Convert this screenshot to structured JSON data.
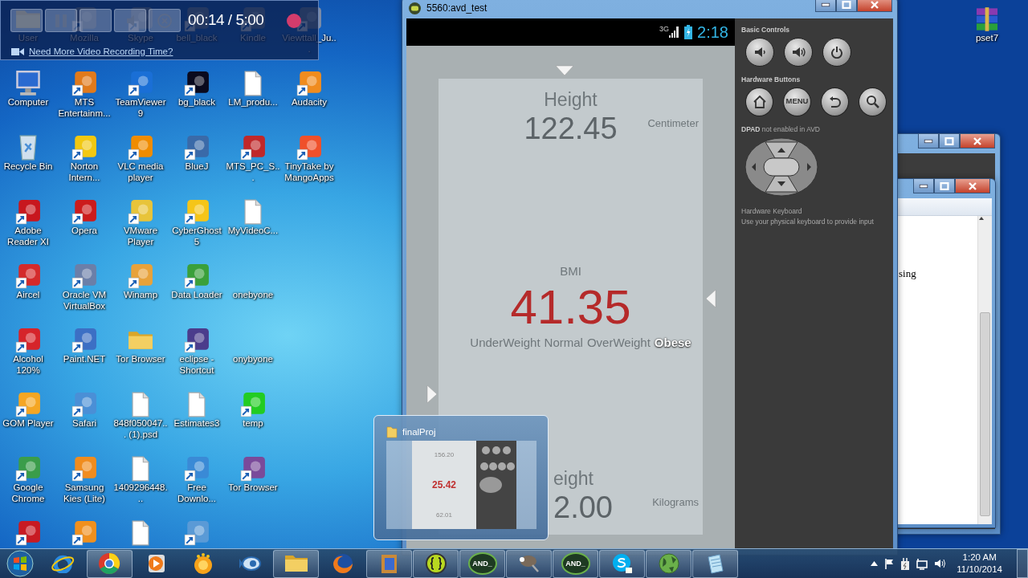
{
  "recorder": {
    "buttons": [
      {
        "kind": "blank"
      },
      {
        "kind": "pause"
      },
      {
        "kind": "blank"
      },
      {
        "kind": "mute"
      },
      {
        "kind": "cancel"
      }
    ],
    "timer": "00:14 / 5:00",
    "recording": true,
    "link": "Need More Video Recording Time?"
  },
  "desktop_icons": [
    {
      "label": "User",
      "kind": "folder"
    },
    {
      "label": "Computer",
      "kind": "computer"
    },
    {
      "label": "Recycle Bin",
      "kind": "bin"
    },
    {
      "label": "Adobe Reader XI",
      "kind": "app",
      "color": "#c8171e"
    },
    {
      "label": "Aircel",
      "kind": "app",
      "color": "#d42a2a"
    },
    {
      "label": "Alcohol 120%",
      "kind": "app",
      "color": "#d6242a"
    },
    {
      "label": "GOM Player",
      "kind": "app",
      "color": "#f5a623"
    },
    {
      "label": "Google Chrome",
      "kind": "app",
      "color": "#3a9d4a"
    },
    {
      "kind": "app",
      "color": "#c81a22"
    },
    {
      "label": "Mozilla",
      "kind": "app"
    },
    {
      "label": "MTS Entertainm...",
      "kind": "app",
      "color": "#e07a1c"
    },
    {
      "label": "Norton Intern...",
      "kind": "app",
      "color": "#f2c811"
    },
    {
      "label": "Opera",
      "kind": "app",
      "color": "#cc1b1b"
    },
    {
      "label": "Oracle VM VirtualBox",
      "kind": "app",
      "color": "#6b7fa8"
    },
    {
      "label": "Paint.NET",
      "kind": "app",
      "color": "#3c6fc4"
    },
    {
      "label": "Safari",
      "kind": "app",
      "color": "#4a8fd6"
    },
    {
      "label": "Samsung Kies (Lite)",
      "kind": "app",
      "color": "#f08c1e"
    },
    {
      "kind": "app",
      "color": "#f0901e"
    },
    {
      "label": "Skype",
      "kind": "app"
    },
    {
      "label": "TeamViewer 9",
      "kind": "app",
      "color": "#1a6fd6"
    },
    {
      "label": "VLC media player",
      "kind": "app",
      "color": "#f08c00"
    },
    {
      "label": "VMware Player",
      "kind": "app",
      "color": "#e8c43a"
    },
    {
      "label": "Winamp",
      "kind": "app",
      "color": "#e8a23a"
    },
    {
      "label": "Tor Browser",
      "kind": "folder"
    },
    {
      "label": "848f050047... (1).psd",
      "kind": "file"
    },
    {
      "label": "1409296448...",
      "kind": "file"
    },
    {
      "kind": "file"
    },
    {
      "label": "bell_black",
      "kind": "app"
    },
    {
      "label": "bg_black",
      "kind": "app",
      "color": "#0a0a1e"
    },
    {
      "label": "BlueJ",
      "kind": "app",
      "color": "#3a6aa8"
    },
    {
      "label": "CyberGhost 5",
      "kind": "app",
      "color": "#f5c518"
    },
    {
      "label": "Data Loader",
      "kind": "app",
      "color": "#3aa03a"
    },
    {
      "label": "eclipse - Shortcut",
      "kind": "app",
      "color": "#4b3c8c"
    },
    {
      "label": "Estimates3",
      "kind": "file"
    },
    {
      "label": "Free Downlo...",
      "kind": "app",
      "color": "#3a8ad6"
    },
    {
      "kind": "app",
      "color": "#5a9ad6"
    },
    {
      "label": "Kindle",
      "kind": "app"
    },
    {
      "label": "LM_produ...",
      "kind": "file"
    },
    {
      "label": "MTS_PC_S...",
      "kind": "app",
      "color": "#c0282a"
    },
    {
      "label": "MyVideoC...",
      "kind": "file"
    },
    {
      "label": "onebyone",
      "kind": "blank"
    },
    {
      "label": "onybyone",
      "kind": "blank"
    },
    {
      "label": "temp",
      "kind": "app",
      "color": "#22cc22"
    },
    {
      "label": "Tor Browser",
      "kind": "app",
      "color": "#7a4a9a"
    },
    {
      "kind": "blank"
    },
    {
      "label": "Viewttall_Ju...",
      "kind": "app"
    },
    {
      "label": "Audacity",
      "kind": "app",
      "color": "#f08c1e"
    },
    {
      "label": "TinyTake by MangoApps",
      "kind": "app",
      "color": "#f0502a"
    }
  ],
  "desktop_icon_right": {
    "label": "pset7"
  },
  "back_window": {
    "text": "sing"
  },
  "emulator": {
    "title": "5560:avd_test",
    "status_bar": {
      "network": "3G",
      "time": "2:18"
    },
    "height": {
      "label": "Height",
      "value": "122.45",
      "unit": "Centimeter"
    },
    "bmi": {
      "label": "BMI",
      "value": "41.35",
      "scale": [
        {
          "label": "UnderWeight",
          "selected": false
        },
        {
          "label": "Normal",
          "selected": false
        },
        {
          "label": "OverWeight",
          "selected": false
        },
        {
          "label": "Obese",
          "selected": true
        }
      ]
    },
    "weight": {
      "label": "eight",
      "value": "2.00",
      "unit": "Kilograms"
    },
    "panel": {
      "sections": [
        {
          "title": "Basic Controls",
          "buttons": [
            {
              "kind": "volume_down"
            },
            {
              "kind": "volume_up"
            },
            {
              "kind": "power"
            }
          ]
        },
        {
          "title": "Hardware Buttons",
          "buttons": [
            {
              "kind": "home"
            },
            {
              "kind": "menu",
              "label": "MENU"
            },
            {
              "kind": "back"
            },
            {
              "kind": "search"
            }
          ]
        }
      ],
      "dpad_note": "**DPAD** not enabled in AVD",
      "keyboard_title": "Hardware Keyboard",
      "keyboard_note": "Use your physical keyboard to provide input"
    }
  },
  "preview": {
    "title": "finalProj",
    "values": [
      "156.20",
      "25.42",
      "62.01"
    ]
  },
  "taskbar": {
    "buttons": [
      {
        "kind": "ie",
        "running": false
      },
      {
        "kind": "chrome",
        "running": true
      },
      {
        "kind": "media",
        "running": false
      },
      {
        "kind": "gom",
        "running": false
      },
      {
        "kind": "fish",
        "running": false
      },
      {
        "kind": "folder",
        "running": true
      },
      {
        "kind": "firefox",
        "running": false
      },
      {
        "kind": "word",
        "running": true
      },
      {
        "kind": "braces",
        "running": true
      },
      {
        "kind": "and",
        "label": "AND_",
        "running": true
      },
      {
        "kind": "gimp",
        "running": true
      },
      {
        "kind": "and",
        "label": "AND_",
        "running": true
      },
      {
        "kind": "skype",
        "running": true
      },
      {
        "kind": "globe",
        "running": true
      },
      {
        "kind": "notepad",
        "running": true
      }
    ],
    "clock": {
      "time": "1:20 AM",
      "date": "11/10/2014"
    }
  }
}
